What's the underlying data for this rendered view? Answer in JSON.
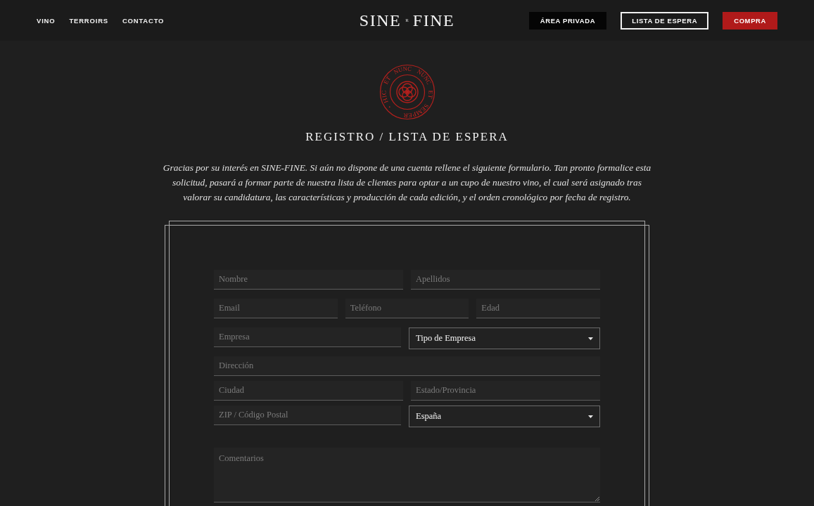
{
  "header": {
    "nav": [
      "VINO",
      "TERROIRS",
      "CONTACTO"
    ],
    "logo": {
      "left": "SINE",
      "mark": "R",
      "right": "FINE"
    },
    "actions": [
      {
        "label": "ÁREA PRIVADA",
        "kind": "dark"
      },
      {
        "label": "LISTA DE ESPERA",
        "kind": "outline"
      },
      {
        "label": "COMPRA",
        "kind": "accent"
      }
    ]
  },
  "seal": {
    "text": "HIC ET NUNC NUNC ET SEMPER"
  },
  "title": "REGISTRO / LISTA DE ESPERA",
  "intro": "Gracias por su interés en SINE-FINE. Si aún no dispone de una cuenta rellene el siguiente formulario. Tan pronto formalice esta solicitud, pasará a formar parte de nuestra lista de clientes para optar a un cupo de nuestro vino, el cual será asignado tras valorar su candidatura, las características y producción de cada edición, y el orden cronológico por fecha de registro.",
  "form": {
    "rows": [
      {
        "fields": [
          {
            "kind": "input",
            "placeholder": "Nombre"
          },
          {
            "kind": "input",
            "placeholder": "Apellidos"
          }
        ]
      },
      {
        "fields": [
          {
            "kind": "input",
            "placeholder": "Email"
          },
          {
            "kind": "input",
            "placeholder": "Teléfono"
          },
          {
            "kind": "input",
            "placeholder": "Edad"
          }
        ]
      },
      {
        "fields": [
          {
            "kind": "input",
            "placeholder": "Empresa"
          },
          {
            "kind": "select",
            "value": "Tipo de Empresa"
          }
        ]
      },
      {
        "fields": [
          {
            "kind": "input",
            "placeholder": "Dirección"
          }
        ]
      },
      {
        "fields": [
          {
            "kind": "input",
            "placeholder": "Ciudad"
          },
          {
            "kind": "input",
            "placeholder": "Estado/Provincia"
          }
        ]
      },
      {
        "fields": [
          {
            "kind": "input",
            "placeholder": "ZIP / Código Postal"
          },
          {
            "kind": "select",
            "value": "España"
          }
        ]
      }
    ],
    "comments": {
      "placeholder": "Comentarios"
    }
  }
}
